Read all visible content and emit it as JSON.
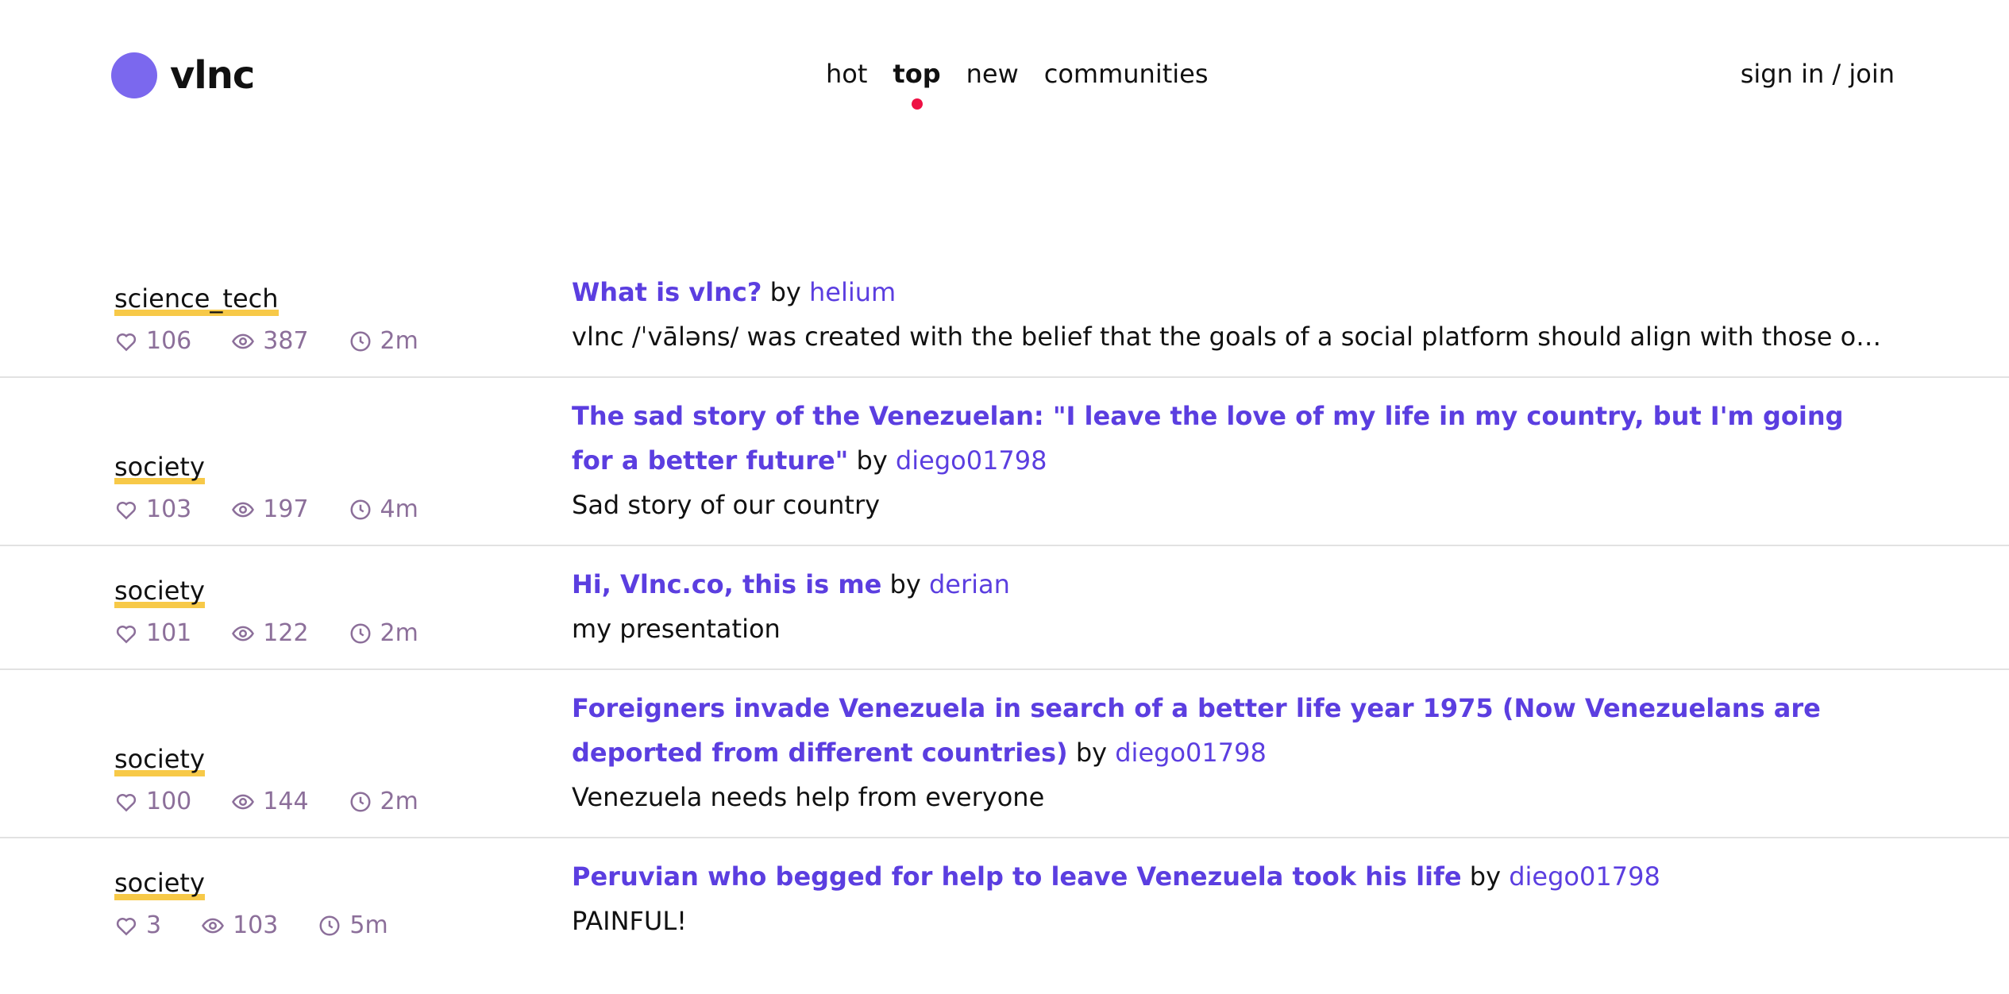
{
  "header": {
    "brand": "vlnc",
    "nav": [
      {
        "label": "hot",
        "active": false
      },
      {
        "label": "top",
        "active": true
      },
      {
        "label": "new",
        "active": false
      },
      {
        "label": "communities",
        "active": false
      }
    ],
    "signin": "sign in / join"
  },
  "colors": {
    "accent": "#5b3ee0",
    "logo": "#7b68ee",
    "active_dot": "#ee1144",
    "community_underline": "#f7c948",
    "stat_text": "#8c6f9a"
  },
  "icons": {
    "likes": "heart-icon",
    "views": "eye-icon",
    "time": "clock-icon"
  },
  "posts": [
    {
      "community": "science_tech",
      "likes": "106",
      "views": "387",
      "time": "2m",
      "title": "What is vlnc?",
      "by": "by",
      "author": "helium",
      "excerpt": "vlnc /ˈvāləns/ was created with the belief that the goals of a social platform should align with those of its user..."
    },
    {
      "community": "society",
      "likes": "103",
      "views": "197",
      "time": "4m",
      "title": "The sad story of the Venezuelan: \"I leave the love of my life in my country, but I'm going for a better future\"",
      "by": "by",
      "author": "diego01798",
      "excerpt": "Sad story of our country"
    },
    {
      "community": "society",
      "likes": "101",
      "views": "122",
      "time": "2m",
      "title": "Hi, Vlnc.co, this is me",
      "by": "by",
      "author": "derian",
      "excerpt": "my presentation"
    },
    {
      "community": "society",
      "likes": "100",
      "views": "144",
      "time": "2m",
      "title": "Foreigners invade Venezuela in search of a better life year 1975 (Now Venezuelans are deported from different countries)",
      "by": "by",
      "author": "diego01798",
      "excerpt": "Venezuela needs help from everyone"
    },
    {
      "community": "society",
      "likes": "3",
      "views": "103",
      "time": "5m",
      "title": "Peruvian who begged for help to leave Venezuela took his life",
      "by": "by",
      "author": "diego01798",
      "excerpt": "PAINFUL!"
    }
  ]
}
